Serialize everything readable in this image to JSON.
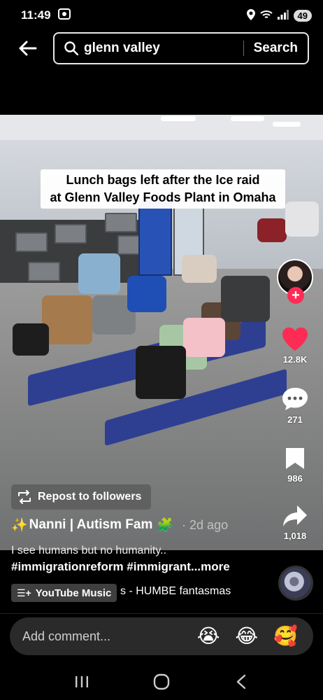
{
  "status_bar": {
    "time": "11:49",
    "battery": "49",
    "signal_label": "5"
  },
  "search": {
    "query": "glenn valley",
    "button_label": "Search"
  },
  "video": {
    "caption_line1": "Lunch bags left after the Ice raid",
    "caption_line2": "at Glenn Valley Foods Plant in Omaha"
  },
  "actions": {
    "likes": "12.8K",
    "comments": "271",
    "saves": "986",
    "shares": "1,018"
  },
  "post": {
    "repost_label": "Repost to followers",
    "author_name": "Nanni | Autism Fam",
    "date": "2d ago",
    "description_line1": "I see humans but no humanity..",
    "description_line2": "#immigrationreform #immigrant...more",
    "music_badge": "YouTube Music",
    "music_track": "s - HUMBE     fantasmas"
  },
  "comment": {
    "placeholder": "Add comment...",
    "emojis": [
      "😭",
      "😂",
      "🥰"
    ]
  },
  "colors": {
    "like_red": "#fe2c55",
    "background": "#000000"
  }
}
